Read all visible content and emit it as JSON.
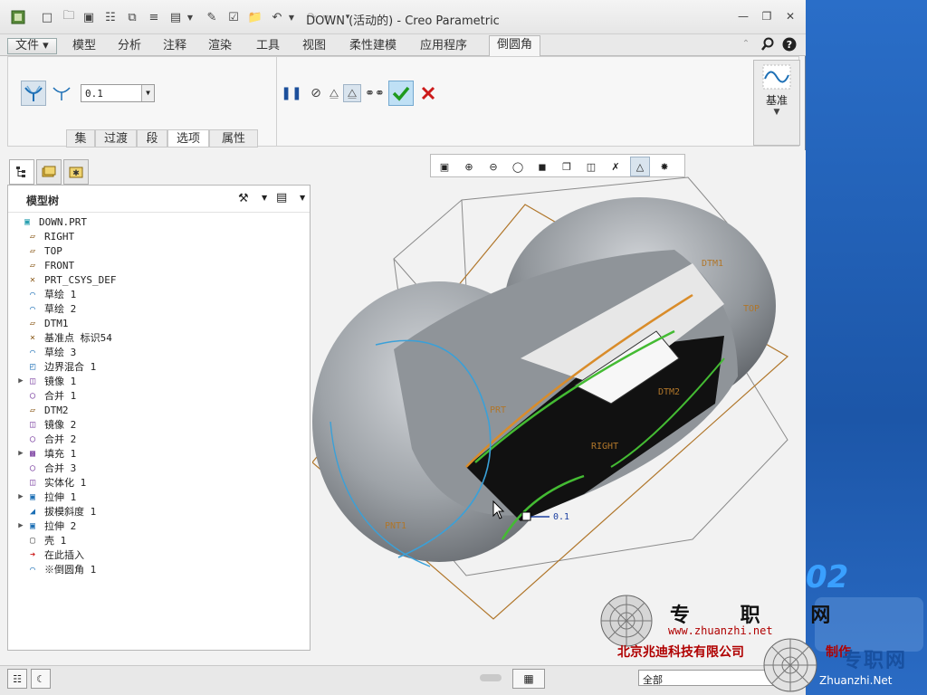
{
  "window": {
    "title": "DOWN (活动的) - Creo Parametric"
  },
  "ribbon": {
    "tabs": [
      {
        "label": "文件"
      },
      {
        "label": "模型"
      },
      {
        "label": "分析"
      },
      {
        "label": "注释"
      },
      {
        "label": "渲染"
      },
      {
        "label": "工具"
      },
      {
        "label": "视图"
      },
      {
        "label": "柔性建模"
      },
      {
        "label": "应用程序"
      },
      {
        "label": "倒圆角"
      }
    ],
    "active_tab": "倒圆角",
    "radius_value": "0.1",
    "subtabs": [
      "集",
      "过渡",
      "段",
      "选项",
      "属性"
    ],
    "active_subtab": "选项",
    "datum_group_label": "基准"
  },
  "model_tree": {
    "title": "模型树",
    "items": [
      {
        "label": "DOWN.PRT",
        "icon": "part-icon",
        "expandable": false
      },
      {
        "label": "RIGHT",
        "icon": "datum-plane-icon",
        "expandable": false
      },
      {
        "label": "TOP",
        "icon": "datum-plane-icon",
        "expandable": false
      },
      {
        "label": "FRONT",
        "icon": "datum-plane-icon",
        "expandable": false
      },
      {
        "label": "PRT_CSYS_DEF",
        "icon": "csys-icon",
        "expandable": false
      },
      {
        "label": "草绘 1",
        "icon": "sketch-icon",
        "expandable": false
      },
      {
        "label": "草绘 2",
        "icon": "sketch-icon",
        "expandable": false
      },
      {
        "label": "DTM1",
        "icon": "datum-plane-icon",
        "expandable": false
      },
      {
        "label": "基准点 标识54",
        "icon": "datum-point-icon",
        "expandable": false
      },
      {
        "label": "草绘 3",
        "icon": "sketch-icon",
        "expandable": false
      },
      {
        "label": "边界混合 1",
        "icon": "boundary-blend-icon",
        "expandable": false
      },
      {
        "label": "镜像 1",
        "icon": "mirror-icon",
        "expandable": true
      },
      {
        "label": "合并 1",
        "icon": "merge-icon",
        "expandable": false
      },
      {
        "label": "DTM2",
        "icon": "datum-plane-icon",
        "expandable": false
      },
      {
        "label": "镜像 2",
        "icon": "mirror-icon",
        "expandable": false
      },
      {
        "label": "合并 2",
        "icon": "merge-icon",
        "expandable": false
      },
      {
        "label": "填充 1",
        "icon": "fill-icon",
        "expandable": true
      },
      {
        "label": "合并 3",
        "icon": "merge-icon",
        "expandable": false
      },
      {
        "label": "实体化 1",
        "icon": "solidify-icon",
        "expandable": false
      },
      {
        "label": "拉伸 1",
        "icon": "extrude-icon",
        "expandable": true
      },
      {
        "label": "拔模斜度 1",
        "icon": "draft-icon",
        "expandable": false
      },
      {
        "label": "拉伸 2",
        "icon": "extrude-icon",
        "expandable": true
      },
      {
        "label": "壳 1",
        "icon": "shell-icon",
        "expandable": false
      },
      {
        "label": "在此插入",
        "icon": "insert-here-icon",
        "expandable": false
      },
      {
        "label": "※倒圆角 1",
        "icon": "round-icon",
        "expandable": false
      }
    ]
  },
  "viewport": {
    "labels": {
      "dtm1": "DTM1",
      "top": "TOP",
      "prt": "PRT",
      "dtm2": "DTM2",
      "right": "RIGHT",
      "pnt1": "PNT1",
      "radius_tag": "0.1"
    }
  },
  "status": {
    "filter_value": "全部"
  },
  "watermark": {
    "site_name": "专 职 网",
    "site_url": "www.zhuanzhi.net",
    "company": "北京兆迪科技有限公司",
    "logo_text": "专职网",
    "logo_url": "Zhuanzhi.Net",
    "tag": "制作"
  },
  "desktop": {
    "badge": "02"
  },
  "colors": {
    "accent": "#1f5fb0",
    "model_gray": "#8c9196",
    "edge_green": "#44bb33",
    "edge_orange": "#d98c2a",
    "edge_blue": "#3aa0d8",
    "plane_orange": "#b0762a"
  }
}
